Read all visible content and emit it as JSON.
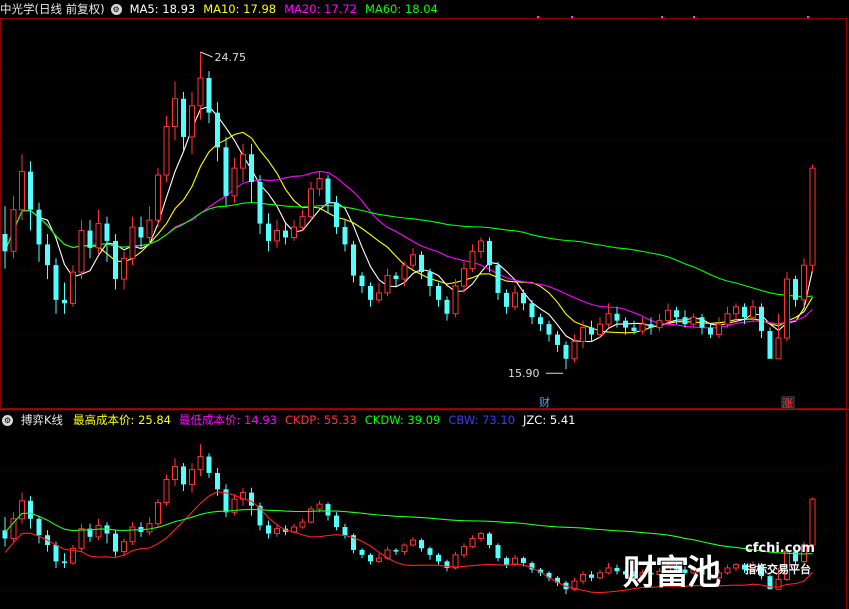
{
  "panel_top": {
    "title": "中光学(日线 前复权)",
    "legend": [
      {
        "text": "MA5: 18.93",
        "color": "#ffffff"
      },
      {
        "text": "MA10: 17.98",
        "color": "#ffff00"
      },
      {
        "text": "MA20: 17.72",
        "color": "#ff00ff"
      },
      {
        "text": "MA60: 18.04",
        "color": "#00ff00"
      }
    ],
    "high_label": "24.75",
    "low_label": "15.90",
    "marker_cai": "财",
    "marker_zhang": "涨"
  },
  "panel_bottom": {
    "title": "搏弈K线",
    "legend": [
      {
        "text": "最高成本价: 25.84",
        "color": "#ffff00"
      },
      {
        "text": "最低成本价: 14.93",
        "color": "#ff00ff"
      },
      {
        "text": "CKDP: 55.33",
        "color": "#ff3333"
      },
      {
        "text": "CKDW: 39.09",
        "color": "#00ff00"
      },
      {
        "text": "CBW: 73.10",
        "color": "#3a3aff"
      },
      {
        "text": "JZC: 5.41",
        "color": "#ffffff"
      }
    ]
  },
  "watermark": {
    "brand": "财富池",
    "url": "cfchi.com",
    "tagline": "指标交易平台"
  },
  "chart_data": [
    {
      "type": "candlestick",
      "name": "中光学(日线 前复权)",
      "ylim": [
        15.0,
        25.5
      ],
      "high": 24.75,
      "low": 15.9,
      "series": [
        {
          "name": "MA5",
          "color": "#ffffff",
          "last": 18.93
        },
        {
          "name": "MA10",
          "color": "#ffff00",
          "last": 17.98
        },
        {
          "name": "MA20",
          "color": "#ff00ff",
          "last": 17.72
        },
        {
          "name": "MA60",
          "color": "#00ff00",
          "last": 18.04
        }
      ],
      "ohlc": [
        [
          19.5,
          19.0,
          20.3,
          18.5
        ],
        [
          19.0,
          20.2,
          20.6,
          18.8
        ],
        [
          20.2,
          21.3,
          21.8,
          19.9
        ],
        [
          21.3,
          20.2,
          21.6,
          19.6
        ],
        [
          20.2,
          19.2,
          20.4,
          18.7
        ],
        [
          19.2,
          18.6,
          19.5,
          18.2
        ],
        [
          18.6,
          17.6,
          18.8,
          17.2
        ],
        [
          17.6,
          17.5,
          18.1,
          17.2
        ],
        [
          17.5,
          18.4,
          18.6,
          17.4
        ],
        [
          18.4,
          19.6,
          19.9,
          18.2
        ],
        [
          19.6,
          19.1,
          19.9,
          18.8
        ],
        [
          19.1,
          19.8,
          20.2,
          18.9
        ],
        [
          19.8,
          19.3,
          20.0,
          18.7
        ],
        [
          19.3,
          18.2,
          19.5,
          17.9
        ],
        [
          18.2,
          18.8,
          19.0,
          17.9
        ],
        [
          18.8,
          19.7,
          20.0,
          18.6
        ],
        [
          19.7,
          19.4,
          20.0,
          19.1
        ],
        [
          19.4,
          19.9,
          20.3,
          19.2
        ],
        [
          19.9,
          21.2,
          21.4,
          19.7
        ],
        [
          21.2,
          22.6,
          22.9,
          21.0
        ],
        [
          22.6,
          23.4,
          23.9,
          22.2
        ],
        [
          23.4,
          22.3,
          23.6,
          21.9
        ],
        [
          22.3,
          23.2,
          23.6,
          21.8
        ],
        [
          23.2,
          24.0,
          24.75,
          22.8
        ],
        [
          24.0,
          23.0,
          24.2,
          22.7
        ],
        [
          23.0,
          22.0,
          23.3,
          21.6
        ],
        [
          22.0,
          20.6,
          22.3,
          20.3
        ],
        [
          20.6,
          21.4,
          21.7,
          20.4
        ],
        [
          21.4,
          21.8,
          22.1,
          21.0
        ],
        [
          21.8,
          21.0,
          22.1,
          20.4
        ],
        [
          21.0,
          19.8,
          21.2,
          19.5
        ],
        [
          19.8,
          19.3,
          20.1,
          19.0
        ],
        [
          19.3,
          19.6,
          19.9,
          19.1
        ],
        [
          19.6,
          19.4,
          19.8,
          19.2
        ],
        [
          19.4,
          19.7,
          19.9,
          19.3
        ],
        [
          19.7,
          20.0,
          20.2,
          19.6
        ],
        [
          20.0,
          20.8,
          21.0,
          19.9
        ],
        [
          20.8,
          21.1,
          21.3,
          20.6
        ],
        [
          21.1,
          20.4,
          21.2,
          20.1
        ],
        [
          20.4,
          19.7,
          20.6,
          19.5
        ],
        [
          19.7,
          19.2,
          19.9,
          19.0
        ],
        [
          19.2,
          18.3,
          19.3,
          18.1
        ],
        [
          18.3,
          18.0,
          18.4,
          17.8
        ],
        [
          18.0,
          17.6,
          18.1,
          17.4
        ],
        [
          17.6,
          17.8,
          18.1,
          17.5
        ],
        [
          17.8,
          18.3,
          18.5,
          17.7
        ],
        [
          18.3,
          18.2,
          18.4,
          18.0
        ],
        [
          18.2,
          18.6,
          18.7,
          18.0
        ],
        [
          18.6,
          18.9,
          19.1,
          18.5
        ],
        [
          18.9,
          18.4,
          19.0,
          18.2
        ],
        [
          18.4,
          18.0,
          18.5,
          17.7
        ],
        [
          18.0,
          17.6,
          18.1,
          17.4
        ],
        [
          17.6,
          17.2,
          17.7,
          17.0
        ],
        [
          17.2,
          18.0,
          18.2,
          17.1
        ],
        [
          18.0,
          18.5,
          18.7,
          17.8
        ],
        [
          18.5,
          19.0,
          19.2,
          18.4
        ],
        [
          19.0,
          19.3,
          19.4,
          18.8
        ],
        [
          19.3,
          18.6,
          19.4,
          18.4
        ],
        [
          18.6,
          17.8,
          18.7,
          17.6
        ],
        [
          17.8,
          17.4,
          17.9,
          17.2
        ],
        [
          17.4,
          17.8,
          18.0,
          17.3
        ],
        [
          17.8,
          17.5,
          17.9,
          17.3
        ],
        [
          17.5,
          17.1,
          17.6,
          16.9
        ],
        [
          17.1,
          16.9,
          17.2,
          16.7
        ],
        [
          16.9,
          16.6,
          17.0,
          16.4
        ],
        [
          16.6,
          16.3,
          16.7,
          16.1
        ],
        [
          16.3,
          15.9,
          16.4,
          15.6
        ],
        [
          15.9,
          16.4,
          16.6,
          15.8
        ],
        [
          16.4,
          16.8,
          17.0,
          16.2
        ],
        [
          16.8,
          16.6,
          17.0,
          16.4
        ],
        [
          16.6,
          16.9,
          17.1,
          16.5
        ],
        [
          16.9,
          17.2,
          17.5,
          16.8
        ],
        [
          17.2,
          17.0,
          17.4,
          16.8
        ],
        [
          17.0,
          16.8,
          17.1,
          16.6
        ],
        [
          16.8,
          16.7,
          17.0,
          16.6
        ],
        [
          16.7,
          16.9,
          17.1,
          16.6
        ],
        [
          16.9,
          16.8,
          17.1,
          16.6
        ],
        [
          16.8,
          17.0,
          17.2,
          16.7
        ],
        [
          17.0,
          17.3,
          17.5,
          16.9
        ],
        [
          17.3,
          17.1,
          17.4,
          16.9
        ],
        [
          17.1,
          16.9,
          17.3,
          16.8
        ],
        [
          16.9,
          17.1,
          17.2,
          16.8
        ],
        [
          17.1,
          16.8,
          17.2,
          16.6
        ],
        [
          16.8,
          16.6,
          16.9,
          16.5
        ],
        [
          16.6,
          16.9,
          17.1,
          16.5
        ],
        [
          16.9,
          17.2,
          17.4,
          16.8
        ],
        [
          17.2,
          17.4,
          17.5,
          17.0
        ],
        [
          17.4,
          17.1,
          17.5,
          16.9
        ],
        [
          17.1,
          17.4,
          17.6,
          17.0
        ],
        [
          17.4,
          16.7,
          17.5,
          16.5
        ],
        [
          16.7,
          15.9,
          16.8,
          15.9
        ],
        [
          15.9,
          16.5,
          17.2,
          15.9
        ],
        [
          16.5,
          18.2,
          18.4,
          16.4
        ],
        [
          18.2,
          17.6,
          18.3,
          17.4
        ],
        [
          17.6,
          18.6,
          18.8,
          17.4
        ],
        [
          18.6,
          21.4,
          21.5,
          18.4
        ]
      ]
    },
    {
      "type": "line",
      "name": "搏弈K线",
      "ylim": [
        0,
        100
      ],
      "series": [
        {
          "name": "CKDP",
          "color": "#ff3333",
          "last": 55.33
        },
        {
          "name": "CKDW",
          "color": "#00ff00",
          "last": 39.09
        }
      ],
      "last_values": {
        "最高成本价": 25.84,
        "最低成本价": 14.93,
        "CBW": 73.1,
        "JZC": 5.41
      }
    }
  ]
}
